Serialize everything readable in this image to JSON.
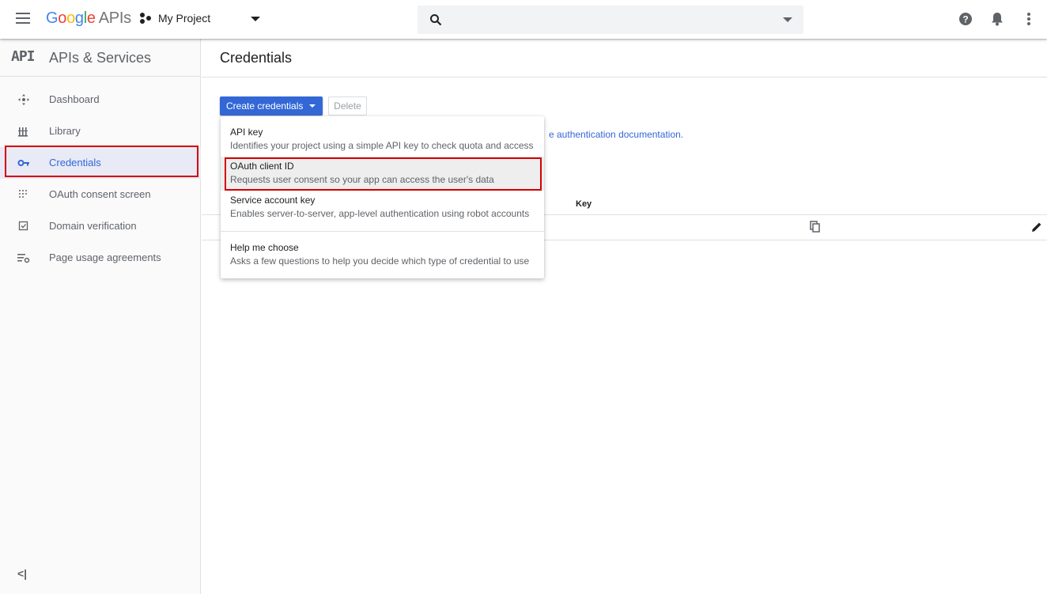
{
  "topbar": {
    "logo_google": [
      "G",
      "o",
      "o",
      "g",
      "l",
      "e"
    ],
    "logo_apis": "APIs",
    "project_name": "My Project",
    "search_placeholder": ""
  },
  "sidebar": {
    "badge": "API",
    "title": "APIs & Services",
    "items": [
      {
        "label": "Dashboard",
        "icon": "dashboard-icon"
      },
      {
        "label": "Library",
        "icon": "library-icon"
      },
      {
        "label": "Credentials",
        "icon": "key-icon",
        "active": true
      },
      {
        "label": "OAuth consent screen",
        "icon": "consent-icon"
      },
      {
        "label": "Domain verification",
        "icon": "checkbox-icon"
      },
      {
        "label": "Page usage agreements",
        "icon": "settings-list-icon"
      }
    ],
    "collapse_label": "<|"
  },
  "main": {
    "title": "Credentials",
    "create_button": "Create credentials",
    "delete_button": "Delete",
    "doc_link": "e authentication documentation.",
    "column_key": "Key"
  },
  "menu": {
    "items": [
      {
        "title": "API key",
        "desc": "Identifies your project using a simple API key to check quota and access"
      },
      {
        "title": "OAuth client ID",
        "desc": "Requests user consent so your app can access the user's data"
      },
      {
        "title": "Service account key",
        "desc": "Enables server-to-server, app-level authentication using robot accounts"
      },
      {
        "title": "Help me choose",
        "desc": "Asks a few questions to help you decide which type of credential to use"
      }
    ]
  },
  "colors": {
    "accent": "#3367d6",
    "highlight": "#d50000"
  }
}
